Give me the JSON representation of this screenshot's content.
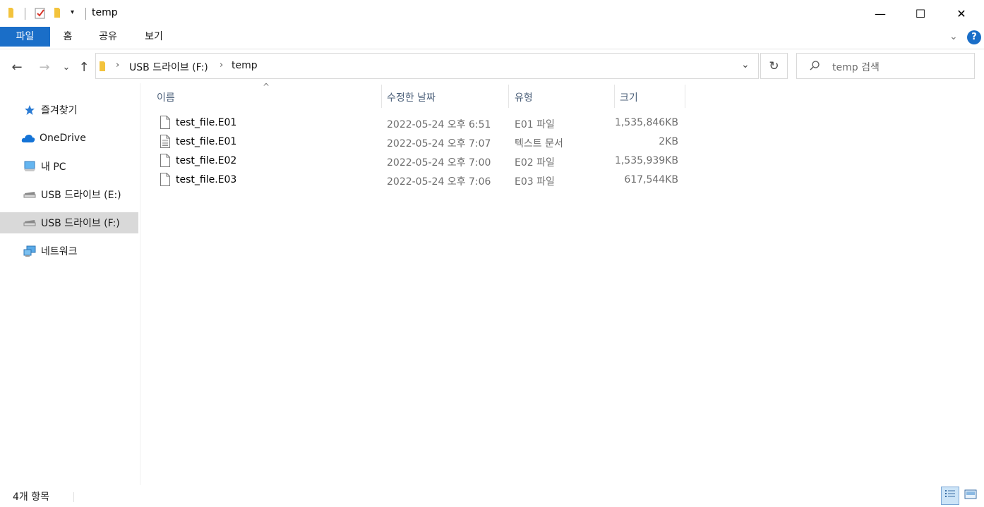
{
  "window": {
    "title": "temp",
    "controls": {
      "minimize": "—",
      "maximize": "☐",
      "close": "✕"
    }
  },
  "ribbon": {
    "tabs": [
      {
        "label": "파일"
      },
      {
        "label": "홈"
      },
      {
        "label": "공유"
      },
      {
        "label": "보기"
      }
    ],
    "help": "?"
  },
  "nav": {
    "back": "←",
    "forward": "→",
    "recent": "⌄",
    "up": "↑",
    "breadcrumb": [
      "USB 드라이브 (F:)",
      "temp"
    ],
    "refresh": "↻",
    "search_placeholder": "temp 검색"
  },
  "sidebar": {
    "items": [
      {
        "label": "즐겨찾기",
        "icon": "star-icon"
      },
      {
        "label": "OneDrive",
        "icon": "cloud-icon"
      },
      {
        "label": "내 PC",
        "icon": "computer-icon"
      },
      {
        "label": "USB 드라이브 (E:)",
        "icon": "drive-icon"
      },
      {
        "label": "USB 드라이브 (F:)",
        "icon": "drive-icon",
        "selected": true
      },
      {
        "label": "네트워크",
        "icon": "network-icon"
      }
    ]
  },
  "columns": {
    "name": "이름",
    "date": "수정한 날짜",
    "type": "유형",
    "size": "크기"
  },
  "files": [
    {
      "name": "test_file.E01",
      "date": "2022-05-24 오후 6:51",
      "type": "E01 파일",
      "size": "1,535,846KB",
      "icon": "file-icon"
    },
    {
      "name": "test_file.E01",
      "date": "2022-05-24 오후 7:07",
      "type": "텍스트 문서",
      "size": "2KB",
      "icon": "text-file-icon"
    },
    {
      "name": "test_file.E02",
      "date": "2022-05-24 오후 7:00",
      "type": "E02 파일",
      "size": "1,535,939KB",
      "icon": "file-icon"
    },
    {
      "name": "test_file.E03",
      "date": "2022-05-24 오후 7:06",
      "type": "E03 파일",
      "size": "617,544KB",
      "icon": "file-icon"
    }
  ],
  "status": {
    "count": "4개 항목"
  }
}
